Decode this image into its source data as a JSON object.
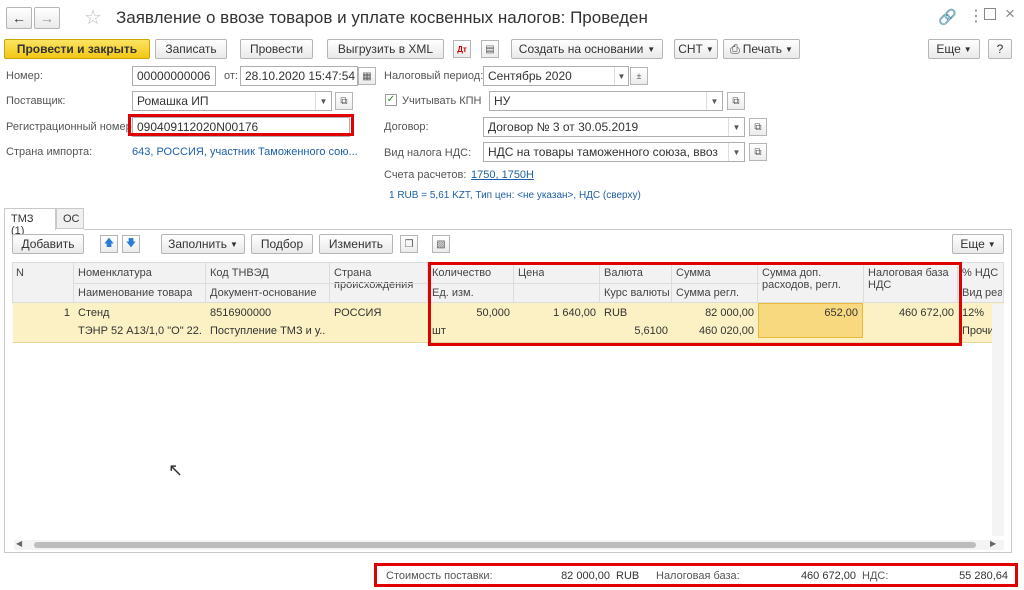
{
  "title": "Заявление о ввозе товаров и уплате косвенных налогов: Проведен",
  "toolbar": {
    "post_close": "Провести и закрыть",
    "save": "Записать",
    "post": "Провести",
    "export_xml": "Выгрузить в XML",
    "create_based": "Создать на основании",
    "snt": "СНТ",
    "print": "Печать",
    "more": "Еще",
    "help": "?"
  },
  "form": {
    "number_label": "Номер:",
    "number_value": "00000000006",
    "from_label": "от:",
    "date_value": "28.10.2020 15:47:54",
    "tax_period_label": "Налоговый период:",
    "tax_period_value": "Сентябрь 2020",
    "supplier_label": "Поставщик:",
    "supplier_value": "Ромашка ИП",
    "kpn_label": "Учитывать КПН",
    "kpn_value": "НУ",
    "reg_number_label": "Регистрационный номер:",
    "reg_number_value": "090409112020N00176",
    "contract_label": "Договор:",
    "contract_value": "Договор № 3 от 30.05.2019",
    "import_country_label": "Страна импорта:",
    "import_country_value": "643, РОССИЯ, участник Таможенного сою...",
    "vat_type_label": "Вид налога НДС:",
    "vat_type_value": "НДС на товары таможенного союза, ввоз",
    "accounts_label": "Счета расчетов:",
    "accounts_value": "1750, 1750Н",
    "rate_info": "1 RUB = 5,61 KZT, Тип цен: <не указан>, НДС (сверху)"
  },
  "tabs": [
    {
      "label": "ТМЗ (1)"
    },
    {
      "label": "ОС"
    }
  ],
  "table_toolbar": {
    "add": "Добавить",
    "fill": "Заполнить",
    "select": "Подбор",
    "change": "Изменить",
    "more": "Еще"
  },
  "table": {
    "headers": {
      "n": "N",
      "nomenclature": "Номенклатура",
      "product_name": "Наименование товара",
      "code": "Код ТНВЭД",
      "basis_doc": "Документ-основание",
      "country": "Страна происхождения",
      "quantity": "Количество",
      "unit": "Ед. изм.",
      "price": "Цена",
      "currency": "Валюта",
      "rate": "Курс валюты",
      "sum": "Сумма",
      "sum_reg": "Сумма регл.",
      "extra": "Сумма доп. расходов, регл.",
      "tax_base": "Налоговая база НДС",
      "vat_pct": "% НДС",
      "vat_kind": "Вид реал"
    },
    "rows": [
      {
        "n": "1",
        "nomenclature": "Стенд",
        "product_name": "ТЭНР 52 А13/1,0 \"О\" 22...",
        "code": "8516900000",
        "basis_doc": "Поступление ТМЗ и у...",
        "country": "РОССИЯ",
        "quantity": "50,000",
        "unit": "шт",
        "price": "1 640,00",
        "currency": "RUB",
        "rate": "5,6100",
        "sum": "82 000,00",
        "sum_reg": "460 020,00",
        "extra": "652,00",
        "tax_base": "460 672,00",
        "vat_pct": "12%",
        "vat_kind": "Прочий о"
      }
    ]
  },
  "footer": {
    "cost_label": "Стоимость поставки:",
    "cost_value": "82 000,00",
    "currency": "RUB",
    "tax_base_label": "Налоговая база:",
    "tax_base_value": "460 672,00",
    "vat_label": "НДС:",
    "vat_value": "55 280,64"
  },
  "colors": {
    "accent_yellow": "#f2c616",
    "selected_row": "#fbf1c4",
    "active_cell": "#f9d980",
    "highlight_red": "#e00000",
    "link": "#1e5fa8"
  }
}
